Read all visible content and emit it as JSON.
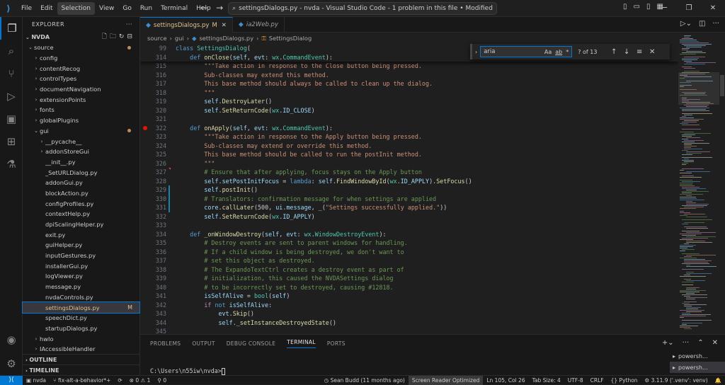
{
  "titlebar": {
    "menus": [
      "File",
      "Edit",
      "Selection",
      "View",
      "Go",
      "Run",
      "Terminal",
      "Help"
    ],
    "selected_menu": "Selection",
    "command_center": "settingsDialogs.py - nvda - Visual Studio Code - 1 problem in this file • Modified"
  },
  "sidebar": {
    "title": "EXPLORER",
    "root": "NVDA",
    "rows": [
      {
        "label": "source",
        "depth": 0,
        "type": "folder-open",
        "dot": true
      },
      {
        "label": "config",
        "depth": 1,
        "type": "folder"
      },
      {
        "label": "contentRecog",
        "depth": 1,
        "type": "folder"
      },
      {
        "label": "controlTypes",
        "depth": 1,
        "type": "folder"
      },
      {
        "label": "documentNavigation",
        "depth": 1,
        "type": "folder"
      },
      {
        "label": "extensionPoints",
        "depth": 1,
        "type": "folder"
      },
      {
        "label": "fonts",
        "depth": 1,
        "type": "folder"
      },
      {
        "label": "globalPlugins",
        "depth": 1,
        "type": "folder"
      },
      {
        "label": "gui",
        "depth": 1,
        "type": "folder-open",
        "dot": true
      },
      {
        "label": "__pycache__",
        "depth": 2,
        "type": "folder"
      },
      {
        "label": "addonStoreGui",
        "depth": 2,
        "type": "folder"
      },
      {
        "label": "__init__.py",
        "depth": 2,
        "type": "file"
      },
      {
        "label": "_SetURLDialog.py",
        "depth": 2,
        "type": "file"
      },
      {
        "label": "addonGui.py",
        "depth": 2,
        "type": "file"
      },
      {
        "label": "blockAction.py",
        "depth": 2,
        "type": "file"
      },
      {
        "label": "configProfiles.py",
        "depth": 2,
        "type": "file"
      },
      {
        "label": "contextHelp.py",
        "depth": 2,
        "type": "file"
      },
      {
        "label": "dpiScalingHelper.py",
        "depth": 2,
        "type": "file"
      },
      {
        "label": "exit.py",
        "depth": 2,
        "type": "file"
      },
      {
        "label": "guiHelper.py",
        "depth": 2,
        "type": "file"
      },
      {
        "label": "inputGestures.py",
        "depth": 2,
        "type": "file"
      },
      {
        "label": "installerGui.py",
        "depth": 2,
        "type": "file"
      },
      {
        "label": "logViewer.py",
        "depth": 2,
        "type": "file"
      },
      {
        "label": "message.py",
        "depth": 2,
        "type": "file"
      },
      {
        "label": "nvdaControls.py",
        "depth": 2,
        "type": "file"
      },
      {
        "label": "settingsDialogs.py",
        "depth": 2,
        "type": "file",
        "selected": true,
        "badge": "M"
      },
      {
        "label": "speechDict.py",
        "depth": 2,
        "type": "file"
      },
      {
        "label": "startupDialogs.py",
        "depth": 2,
        "type": "file"
      },
      {
        "label": "hwIo",
        "depth": 1,
        "type": "folder"
      },
      {
        "label": "IAccessibleHandler",
        "depth": 1,
        "type": "folder"
      }
    ],
    "outline": "OUTLINE",
    "timeline": "TIMELINE"
  },
  "tabs": [
    {
      "label": "settingsDialogs.py",
      "badge": "M",
      "active": true
    },
    {
      "label": "ia2Web.py",
      "active": false
    }
  ],
  "breadcrumb": [
    "source",
    "gui",
    "settingsDialogs.py",
    "SettingsDialog"
  ],
  "find": {
    "value": "aria",
    "options": [
      "Aa",
      "ab",
      "*"
    ],
    "count": "? of 13"
  },
  "sticky": [
    {
      "ln": "99",
      "html": "<span class='k'>class</span> <span class='cl'>SettingsDialog</span>("
    },
    {
      "ln": "314",
      "html": "    <span class='k'>def</span> <span class='f'>onClose</span>(<span class='v'>self</span>, <span class='v'>evt</span>: <span class='cl'>wx</span>.<span class='cl'>CommandEvent</span>):"
    }
  ],
  "code": [
    {
      "ln": "315",
      "html": "        <span class='s'>\"\"\"Take action in response to the Close button being pressed.</span>"
    },
    {
      "ln": "316",
      "html": "        <span class='s'>Sub-classes may extend this method.</span>"
    },
    {
      "ln": "317",
      "html": "        <span class='s'>This base method should always be called to clean up the dialog.</span>"
    },
    {
      "ln": "318",
      "html": "        <span class='s'>\"\"\"</span>"
    },
    {
      "ln": "319",
      "html": "        <span class='v'>self</span>.<span class='f'>DestroyLater</span>()"
    },
    {
      "ln": "320",
      "html": "        <span class='v'>self</span>.<span class='f'>SetReturnCode</span>(<span class='cl'>wx</span>.<span class='v'>ID_CLOSE</span>)"
    },
    {
      "ln": "321",
      "html": ""
    },
    {
      "ln": "322",
      "html": "    <span class='k'>def</span> <span class='f'>onApply</span>(<span class='v'>self</span>, <span class='v'>evt</span>: <span class='cl'>wx</span>.<span class='cl'>CommandEvent</span>):",
      "bp": true
    },
    {
      "ln": "323",
      "html": "        <span class='s'>\"\"\"Take action in response to the Apply button being pressed.</span>"
    },
    {
      "ln": "324",
      "html": "        <span class='s'>Sub-classes may extend or override this method.</span>"
    },
    {
      "ln": "325",
      "html": "        <span class='s'>This base method should be called to run the postInit method.</span>"
    },
    {
      "ln": "326",
      "html": "        <span class='s'>\"\"\"</span>"
    },
    {
      "ln": "327",
      "html": "        <span class='c'># Ensure that after applying, focus stays on the Apply button</span>",
      "mark": "del"
    },
    {
      "ln": "328",
      "html": "        <span class='v'>self</span>.<span class='v'>setPostInitFocus</span> = <span class='k'>lambda</span>: <span class='v'>self</span>.<span class='f'>FindWindowById</span>(<span class='cl'>wx</span>.<span class='v'>ID_APPLY</span>).<span class='f'>SetFocus</span>()"
    },
    {
      "ln": "329",
      "html": "        <span class='v'>self</span>.<span class='f'>postInit</span>()",
      "mark": "mod"
    },
    {
      "ln": "330",
      "html": "        <span class='c'># Translators: confirmation message for when settings are applied</span>",
      "mark": "mod"
    },
    {
      "ln": "331",
      "html": "        <span class='v'>core</span>.<span class='f'>callLater</span>(<span class='p'>500</span>, <span class='v'>ui</span>.<span class='v'>message</span>, <span class='f'>_</span>(<span class='s'>\"Settings successfully applied.\"</span>))",
      "mark": "mod"
    },
    {
      "ln": "332",
      "html": "        <span class='v'>self</span>.<span class='f'>SetReturnCode</span>(<span class='cl'>wx</span>.<span class='v'>ID_APPLY</span>)"
    },
    {
      "ln": "333",
      "html": ""
    },
    {
      "ln": "334",
      "html": "    <span class='k'>def</span> <span class='f'>_onWindowDestroy</span>(<span class='v'>self</span>, <span class='v'>evt</span>: <span class='cl'>wx</span>.<span class='cl'>WindowDestroyEvent</span>):"
    },
    {
      "ln": "335",
      "html": "        <span class='c'># Destroy events are sent to parent windows for handling.</span>"
    },
    {
      "ln": "336",
      "html": "        <span class='c'># If a child window is being destroyed, we don't want to</span>"
    },
    {
      "ln": "337",
      "html": "        <span class='c'># set this object as destroyed.</span>"
    },
    {
      "ln": "338",
      "html": "        <span class='c'># The ExpandoTextCtrl creates a destroy event as part of</span>"
    },
    {
      "ln": "339",
      "html": "        <span class='c'># initialization, this caused the NVDASettings dialog</span>"
    },
    {
      "ln": "340",
      "html": "        <span class='c'># to be incorrectly set to destroyed, causing #12818.</span>"
    },
    {
      "ln": "341",
      "html": "        <span class='v'>isSelfAlive</span> = <span class='cl'>bool</span>(<span class='v'>self</span>)"
    },
    {
      "ln": "342",
      "html": "        <span class='kc'>if</span> <span class='k'>not</span> <span class='v'>isSelfAlive</span>:"
    },
    {
      "ln": "343",
      "html": "            <span class='v'>evt</span>.<span class='f'>Skip</span>()"
    },
    {
      "ln": "344",
      "html": "            <span class='v'>self</span>.<span class='f'>_setInstanceDestroyedState</span>()"
    },
    {
      "ln": "345",
      "html": ""
    }
  ],
  "panel": {
    "tabs": [
      "PROBLEMS",
      "OUTPUT",
      "DEBUG CONSOLE",
      "TERMINAL",
      "PORTS"
    ],
    "active_tab": "TERMINAL",
    "prompt": "C:\\Users\\n55iw\\nvda>",
    "terminals": [
      "powersh...",
      "powersh..."
    ]
  },
  "status": {
    "repo": "nvda",
    "branch": "fix-alt-a-behavior*+",
    "problems_errors": "0",
    "problems_warnings": "1",
    "debug": "0",
    "blame": "Sean Budd (11 months ago)",
    "reader": "Screen Reader Optimized",
    "position": "Ln 105, Col 26",
    "tabsize": "Tab Size: 4",
    "encoding": "UTF-8",
    "eol": "CRLF",
    "language": "Python",
    "interpreter": "3.11.9 ('.venv': venv)"
  },
  "colors": {
    "accent": "#0078d4",
    "modified": "#e2c08d",
    "breakpoint": "#e51400"
  }
}
